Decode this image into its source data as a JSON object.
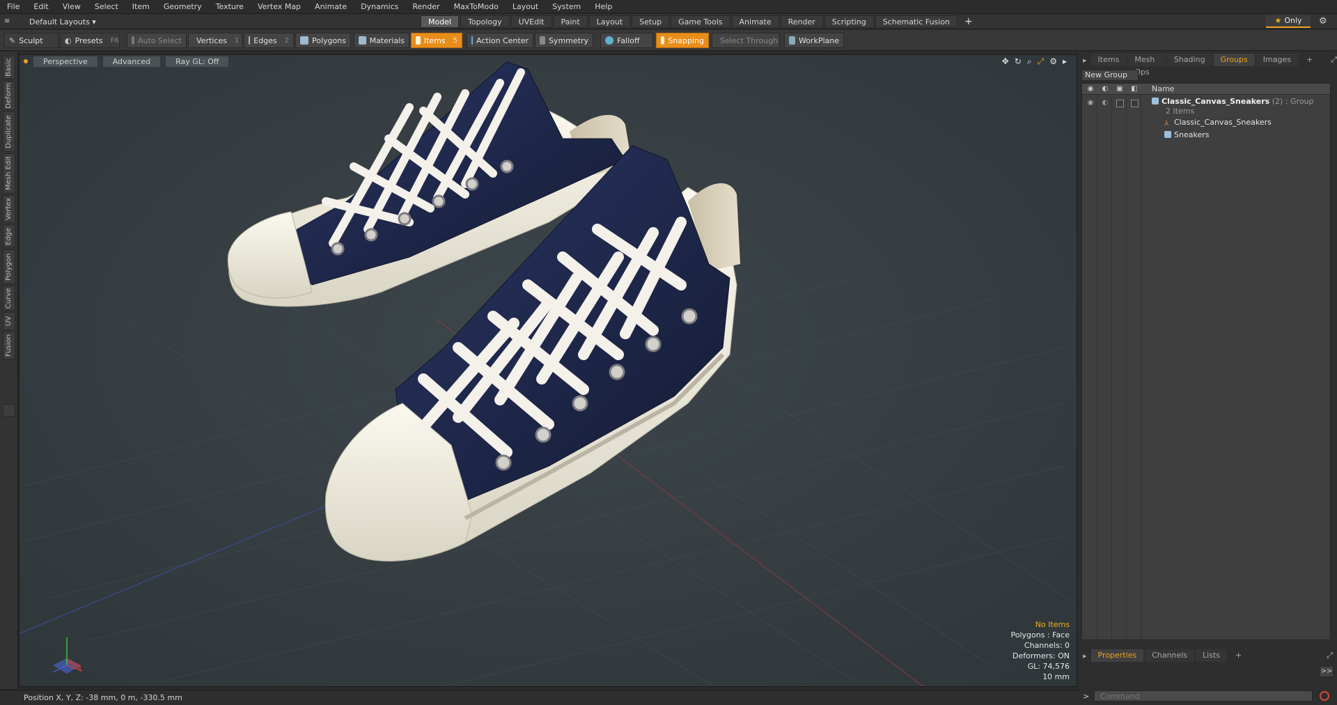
{
  "menu": [
    "File",
    "Edit",
    "View",
    "Select",
    "Item",
    "Geometry",
    "Texture",
    "Vertex Map",
    "Animate",
    "Dynamics",
    "Render",
    "MaxToModo",
    "Layout",
    "System",
    "Help"
  ],
  "layout_selector": {
    "label": "Default Layouts ▾"
  },
  "mode_tabs": [
    {
      "label": "Model",
      "active": true
    },
    {
      "label": "Topology"
    },
    {
      "label": "UVEdit"
    },
    {
      "label": "Paint"
    },
    {
      "label": "Layout"
    },
    {
      "label": "Setup"
    },
    {
      "label": "Game Tools"
    },
    {
      "label": "Animate"
    },
    {
      "label": "Render"
    },
    {
      "label": "Scripting"
    },
    {
      "label": "Schematic Fusion"
    }
  ],
  "mode_tabs_plus": "+",
  "only_button": "Only",
  "toolbar": {
    "sculpt": "Sculpt",
    "presets": "Presets",
    "presets_key": "F6",
    "auto_select": "Auto Select",
    "vertices": "Vertices",
    "vertices_count": "1",
    "edges": "Edges",
    "edges_count": "2",
    "polygons": "Polygons",
    "materials": "Materials",
    "items": "Items",
    "items_count": "5",
    "action_center": "Action Center",
    "symmetry": "Symmetry",
    "falloff": "Falloff",
    "snapping": "Snapping",
    "select_through": "Select Through",
    "workplane": "WorkPlane"
  },
  "left_tabs": [
    "Basic",
    "Deform",
    "Duplicate",
    "Mesh Edit",
    "Vertex",
    "Edge",
    "Polygon",
    "Curve",
    "UV",
    "Fusion"
  ],
  "viewport": {
    "view": "Perspective",
    "shading": "Advanced",
    "raygl": "Ray GL: Off",
    "info": {
      "no_items": "No Items",
      "polygons": "Polygons : Face",
      "channels": "Channels: 0",
      "deformers": "Deformers: ON",
      "gl": "GL: 74,576",
      "scale": "10 mm"
    },
    "colors": {
      "background": "#394247",
      "canvas": "#1f2a4a",
      "rubber": "#efece0",
      "lace": "#f3f1ea"
    }
  },
  "status": {
    "position": "Position X, Y, Z:  -38 mm, 0 m, -330.5 mm"
  },
  "right_panel": {
    "tabs": [
      {
        "label": "Items"
      },
      {
        "label": "Mesh Ops"
      },
      {
        "label": "Shading"
      },
      {
        "label": "Groups",
        "active": true
      },
      {
        "label": "Images"
      },
      {
        "label": "+"
      }
    ],
    "new_group": "New Group",
    "name_header": "Name",
    "group_name": "Classic_Canvas_Sneakers",
    "group_count": "(2)",
    "group_type": ": Group",
    "group_items": "2 Items",
    "child1": "Classic_Canvas_Sneakers",
    "child2": "Sneakers",
    "bottom_tabs": [
      {
        "label": "Properties",
        "active": true
      },
      {
        "label": "Channels"
      },
      {
        "label": "Lists"
      },
      {
        "label": "+"
      }
    ],
    "expand": ">>",
    "command_placeholder": "Command"
  },
  "accent_color": "#f0a11b"
}
